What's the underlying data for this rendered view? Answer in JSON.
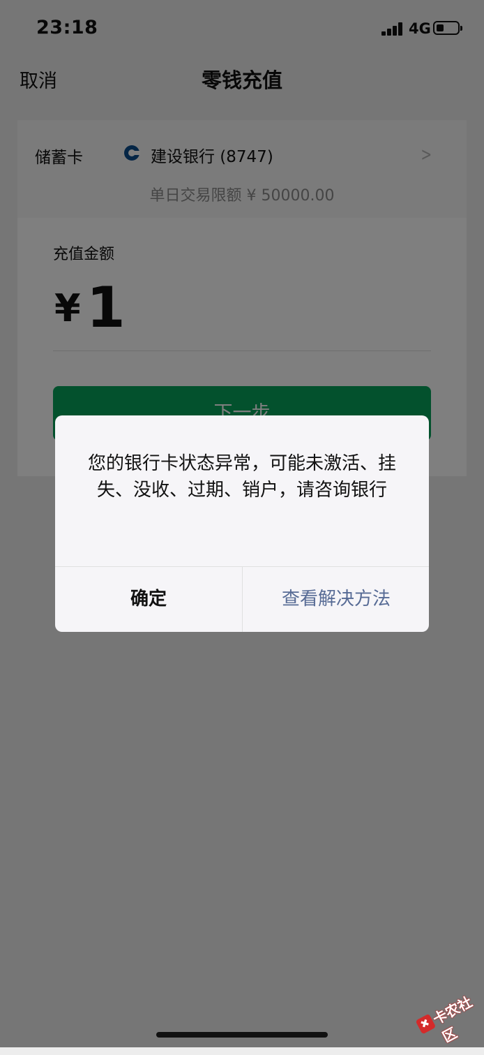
{
  "status_bar": {
    "time": "23:18",
    "network": "4G"
  },
  "nav": {
    "cancel": "取消",
    "title": "零钱充值"
  },
  "card": {
    "type": "储蓄卡",
    "bank": "建设银行 (8747)",
    "limit": "单日交易限额 ¥ 50000.00"
  },
  "recharge": {
    "label": "充值金额",
    "currency": "¥",
    "amount": "1",
    "next": "下一步"
  },
  "dialog": {
    "message": "您的银行卡状态异常，可能未激活、挂失、没收、过期、销户，请咨询银行",
    "confirm": "确定",
    "solution": "查看解决方法"
  },
  "watermark": {
    "text": "卡农社区"
  },
  "colors": {
    "accent": "#07a25a",
    "link": "#576b95"
  }
}
